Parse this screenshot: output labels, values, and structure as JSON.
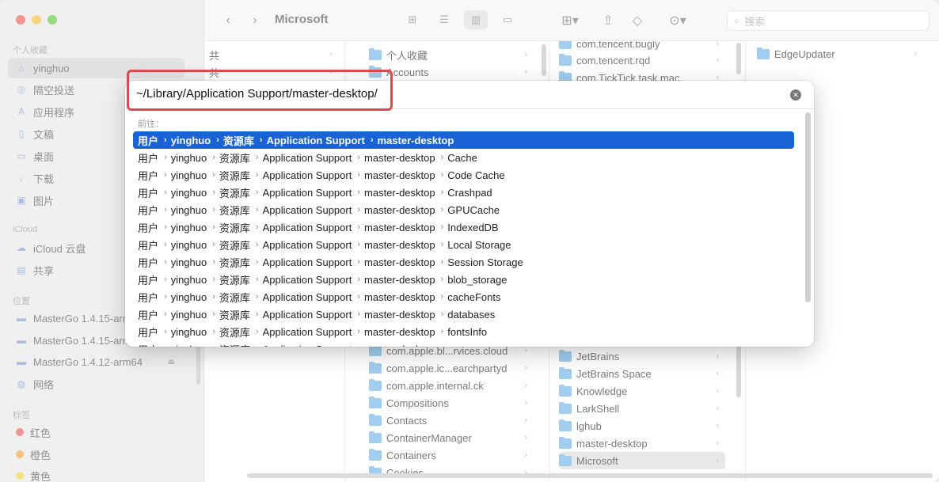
{
  "window": {
    "title": "Microsoft"
  },
  "sidebar": {
    "sections": [
      {
        "label": "个人收藏",
        "items": [
          {
            "label": "yinghuo",
            "icon": "house-icon",
            "selected": true
          },
          {
            "label": "隔空投送",
            "icon": "airdrop-icon"
          },
          {
            "label": "应用程序",
            "icon": "apps-icon"
          },
          {
            "label": "文稿",
            "icon": "document-icon"
          },
          {
            "label": "桌面",
            "icon": "desktop-icon"
          },
          {
            "label": "下载",
            "icon": "download-icon"
          },
          {
            "label": "图片",
            "icon": "photo-icon"
          }
        ]
      },
      {
        "label": "iCloud",
        "items": [
          {
            "label": "iCloud 云盘",
            "icon": "cloud-icon"
          },
          {
            "label": "共享",
            "icon": "shared-folder-icon"
          }
        ]
      },
      {
        "label": "位置",
        "items": [
          {
            "label": "MasterGo 1.4.15-arm64",
            "icon": "disk-icon"
          },
          {
            "label": "MasterGo 1.4.15-arm64",
            "icon": "disk-icon"
          },
          {
            "label": "MasterGo 1.4.12-arm64",
            "icon": "disk-icon",
            "eject": true
          },
          {
            "label": "网络",
            "icon": "network-icon"
          }
        ]
      },
      {
        "label": "标签",
        "items": [
          {
            "label": "红色",
            "color": "#ec5b55"
          },
          {
            "label": "橙色",
            "color": "#f1a33b"
          },
          {
            "label": "黄色",
            "color": "#f3cf3c"
          }
        ]
      }
    ]
  },
  "toolbar": {
    "back_icon": "‹",
    "forward_icon": "›",
    "search_placeholder": "搜索"
  },
  "columns": {
    "col1": [
      "共",
      "共"
    ],
    "col2": [
      "个人收藏",
      "Accounts",
      "com.apple.bl...rvices.cloud",
      "com.apple.ic...earchpartyd",
      "com.apple.internal.ck",
      "Compositions",
      "Contacts",
      "ContainerManager",
      "Containers",
      "Cookies"
    ],
    "col3_top": [
      "com.tencent.bugly",
      "com.tencent.rqd",
      "com.TickTick.task.mac"
    ],
    "col3_bottom": [
      "JetBrains",
      "JetBrains Space",
      "Knowledge",
      "LarkShell",
      "lghub",
      "master-desktop",
      "Microsoft"
    ],
    "col4": [
      "EdgeUpdater"
    ]
  },
  "goto": {
    "path": "~/Library/Application Support/master-desktop/",
    "label": "前往：",
    "base": [
      "用户",
      "yinghuo",
      "资源库",
      "Application Support",
      "master-desktop"
    ],
    "suggestions": [
      "",
      "Cache",
      "Code Cache",
      "Crashpad",
      "GPUCache",
      "IndexedDB",
      "Local Storage",
      "Session Storage",
      "blob_storage",
      "cacheFonts",
      "databases",
      "fontsInfo",
      "…"
    ]
  }
}
